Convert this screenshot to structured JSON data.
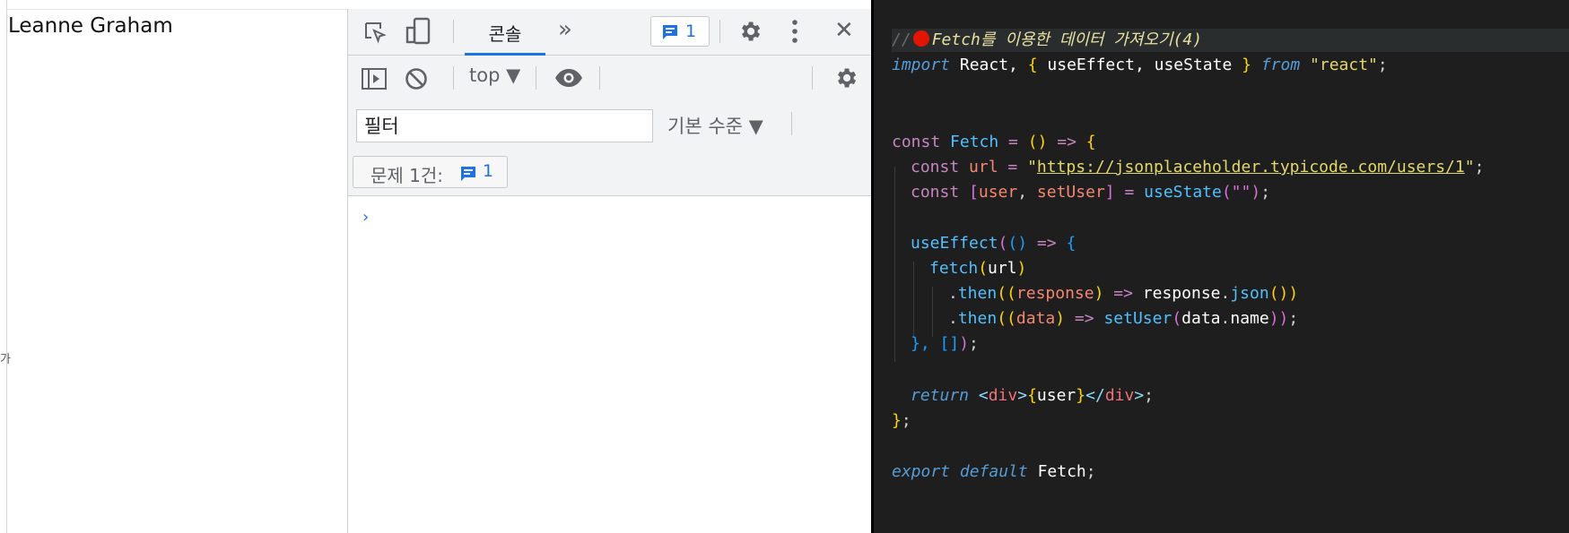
{
  "page": {
    "rendered_text": "Leanne Graham",
    "edge_glyph": "가"
  },
  "devtools": {
    "toolbar": {
      "inspect_icon": "inspect-cursor-icon",
      "device_icon": "device-toolbar-icon",
      "console_tab_label": "콘솔",
      "more_tabs_glyph": "»",
      "issues_count": "1",
      "settings_icon": "gear-icon",
      "menu_icon": "kebab-menu-icon",
      "close_glyph": "✕"
    },
    "console_bar": {
      "sidebar_icon": "show-sidebar-icon",
      "clear_icon": "clear-console-icon",
      "context_value": "top ▼",
      "live_expression_icon": "eye-icon",
      "settings_icon": "gear-icon"
    },
    "filter": {
      "placeholder": "필터",
      "level_label": "기본 수준 ▼"
    },
    "issues": {
      "label": "문제 1건:",
      "count": "1"
    },
    "prompt_glyph": "›"
  },
  "editor": {
    "comment_prefix": "//",
    "comment_emoji_color": "#e51400",
    "comment_text": "Fetch를 이용한 데이터 가져오기(4)",
    "lines": {
      "l1_import": "import",
      "l1_react": " React, ",
      "l1_lb": "{",
      "l1_names": " useEffect, useState ",
      "l1_rb": "}",
      "l1_from": " from ",
      "l1_mod": "\"react\"",
      "l1_semi": ";",
      "l4_const": "const",
      "l4_fetch": " Fetch ",
      "l4_eq": "= ",
      "l4_paren": "()",
      "l4_arrow": " => ",
      "l4_brace": "{",
      "l5_const": "const",
      "l5_url": " url ",
      "l5_eq": "= ",
      "l5_q1": "\"",
      "l5_urlval": "https://jsonplaceholder.typicode.com/users/1",
      "l5_q2": "\"",
      "l5_semi": ";",
      "l6_const": "const",
      "l6_lb": " [",
      "l6_user": "user",
      "l6_comma": ", ",
      "l6_setuser": "setUser",
      "l6_rb": "]",
      "l6_eq": " = ",
      "l6_fn": "useState",
      "l6_args": "(\"\")",
      "l6_semi": ";",
      "l8_fn": "useEffect",
      "l8_p": "(",
      "l8_args": "()",
      "l8_arrow": " => ",
      "l8_brace": "{",
      "l9_fn": "fetch",
      "l9_p1": "(",
      "l9_arg": "url",
      "l9_p2": ")",
      "l10_dot": ".",
      "l10_then": "then",
      "l10_p1": "((",
      "l10_resp": "response",
      "l10_p2": ")",
      "l10_arrow": " => ",
      "l10_obj": "response",
      "l10_dot2": ".",
      "l10_json": "json",
      "l10_p3": "())",
      "l11_dot": ".",
      "l11_then": "then",
      "l11_p1": "((",
      "l11_data": "data",
      "l11_p2": ")",
      "l11_arrow": " => ",
      "l11_set": "setUser",
      "l11_p3": "(",
      "l11_obj": "data",
      "l11_dot2": ".",
      "l11_name": "name",
      "l11_p4": "))",
      "l11_semi": ";",
      "l12_close": "}, []",
      "l12_p": ")",
      "l12_semi": ";",
      "l14_return": "return",
      "l14_open": " <",
      "l14_tag1": "div",
      "l14_gt1": ">",
      "l14_lb": "{",
      "l14_user": "user",
      "l14_rb": "}",
      "l14_lt2": "</",
      "l14_tag2": "div",
      "l14_gt2": ">",
      "l14_semi": ";",
      "l15_close": "}",
      "l15_semi": ";",
      "l17_export": "export",
      "l17_default": " default",
      "l17_name": " Fetch",
      "l17_semi": ";"
    }
  }
}
